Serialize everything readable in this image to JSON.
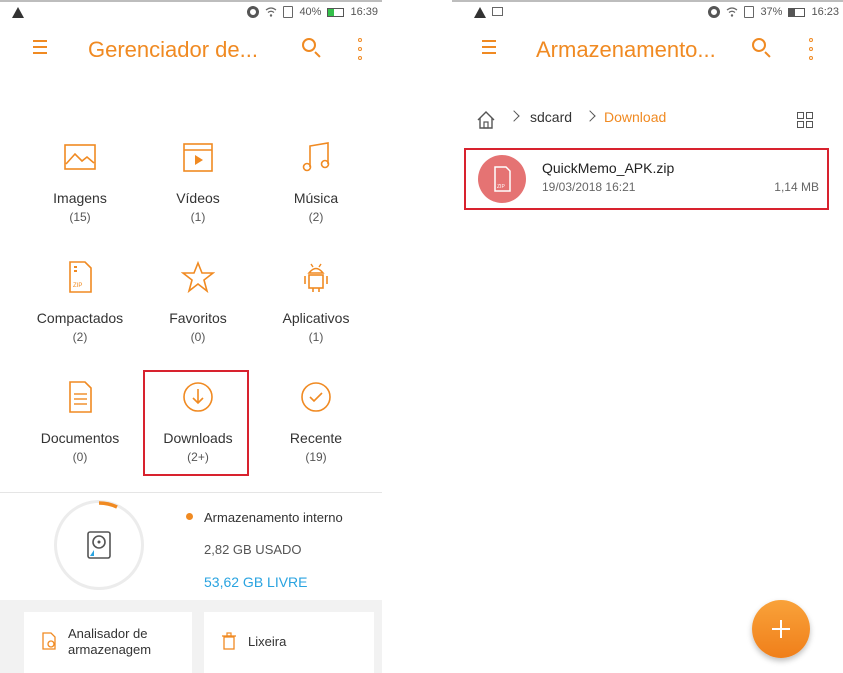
{
  "left_screen": {
    "status_bar": {
      "battery": "40%",
      "time": "16:39"
    },
    "toolbar": {
      "title": "Gerenciador de..."
    },
    "categories": [
      {
        "id": "images",
        "label": "Imagens",
        "count": "(15)",
        "icon": "image-icon"
      },
      {
        "id": "videos",
        "label": "Vídeos",
        "count": "(1)",
        "icon": "video-icon"
      },
      {
        "id": "music",
        "label": "Música",
        "count": "(2)",
        "icon": "music-note-icon"
      },
      {
        "id": "compressed",
        "label": "Compactados",
        "count": "(2)",
        "icon": "zip-file-icon"
      },
      {
        "id": "favorites",
        "label": "Favoritos",
        "count": "(0)",
        "icon": "star-icon"
      },
      {
        "id": "apps",
        "label": "Aplicativos",
        "count": "(1)",
        "icon": "android-icon"
      },
      {
        "id": "documents",
        "label": "Documentos",
        "count": "(0)",
        "icon": "document-icon"
      },
      {
        "id": "downloads",
        "label": "Downloads",
        "count": "(2+)",
        "icon": "download-icon"
      },
      {
        "id": "recent",
        "label": "Recente",
        "count": "(19)",
        "icon": "check-circle-icon"
      }
    ],
    "storage": {
      "name": "Armazenamento interno",
      "used": "2,82 GB USADO",
      "free": "53,62 GB LIVRE"
    },
    "bottom_cards": {
      "analyzer": "Analisador de armazenagem",
      "analyzer_line1": "Analisador de",
      "analyzer_line2": "armazenagem",
      "trash": "Lixeira"
    }
  },
  "right_screen": {
    "status_bar": {
      "battery": "37%",
      "time": "16:23"
    },
    "toolbar": {
      "title": "Armazenamento..."
    },
    "breadcrumb": {
      "root": "sdcard",
      "current": "Download"
    },
    "files": [
      {
        "name": "QuickMemo_APK.zip",
        "date": "19/03/2018 16:21",
        "size": "1,14 MB"
      }
    ]
  },
  "colors": {
    "accent": "#f08a22",
    "free_text": "#29a3e0",
    "highlight": "#d8222e",
    "zip_icon_bg": "#e57373"
  }
}
